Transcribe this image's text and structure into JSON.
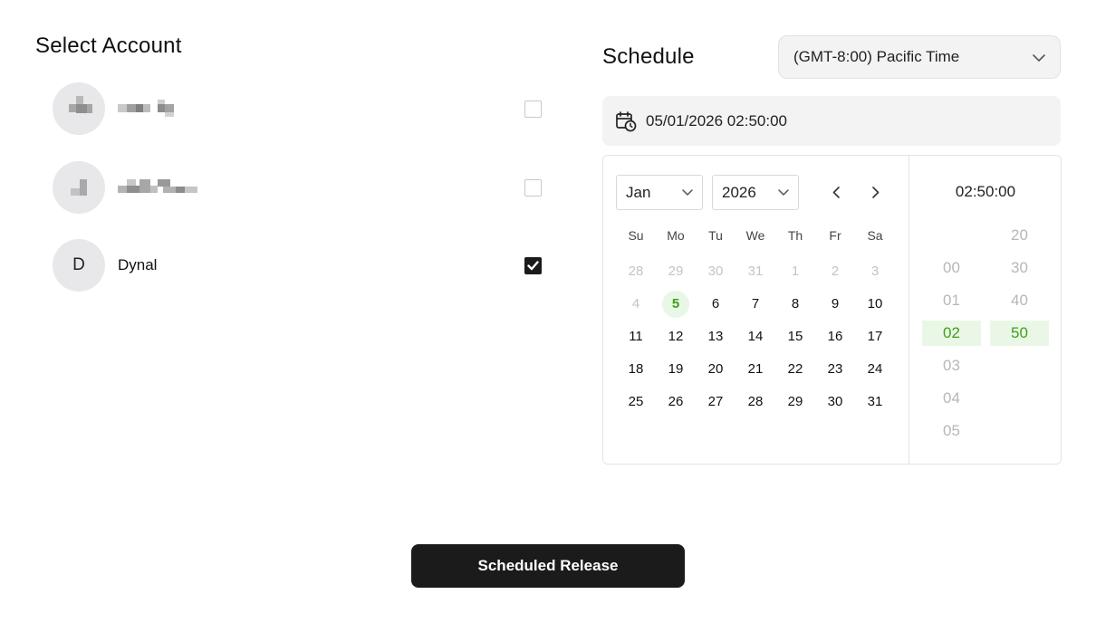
{
  "account_section": {
    "title": "Select Account",
    "accounts": [
      {
        "initial": "",
        "name": "",
        "checked": false
      },
      {
        "initial": "",
        "name": "",
        "checked": false
      },
      {
        "initial": "D",
        "name": "Dynal",
        "checked": true
      }
    ]
  },
  "schedule": {
    "title": "Schedule",
    "timezone": "(GMT-8:00) Pacific Time",
    "datetime_value": "05/01/2026 02:50:00"
  },
  "calendar": {
    "month": "Jan",
    "year": "2026",
    "weekdays": [
      "Su",
      "Mo",
      "Tu",
      "We",
      "Th",
      "Fr",
      "Sa"
    ],
    "weeks": [
      [
        "28",
        "29",
        "30",
        "31",
        "1",
        "2",
        "3"
      ],
      [
        "4",
        "5",
        "6",
        "7",
        "8",
        "9",
        "10"
      ],
      [
        "11",
        "12",
        "13",
        "14",
        "15",
        "16",
        "17"
      ],
      [
        "18",
        "19",
        "20",
        "21",
        "22",
        "23",
        "24"
      ],
      [
        "25",
        "26",
        "27",
        "28",
        "29",
        "30",
        "31"
      ]
    ],
    "muted": [
      [
        0,
        0
      ],
      [
        0,
        1
      ],
      [
        0,
        2
      ],
      [
        0,
        3
      ],
      [
        0,
        4
      ],
      [
        0,
        5
      ],
      [
        0,
        6
      ],
      [
        1,
        0
      ]
    ],
    "highlighted": [
      1,
      1
    ]
  },
  "time": {
    "display": "02:50:00",
    "hours": [
      "00",
      "01",
      "02",
      "03",
      "04",
      "05"
    ],
    "selected_hour": "02",
    "minutes": [
      "20",
      "30",
      "40",
      "50"
    ],
    "selected_minute": "50"
  },
  "actions": {
    "release_label": "Scheduled Release"
  },
  "colors": {
    "accent_green": "#3da11a",
    "accent_green_bg": "#eaf7e6",
    "primary_button": "#1b1b1b"
  }
}
